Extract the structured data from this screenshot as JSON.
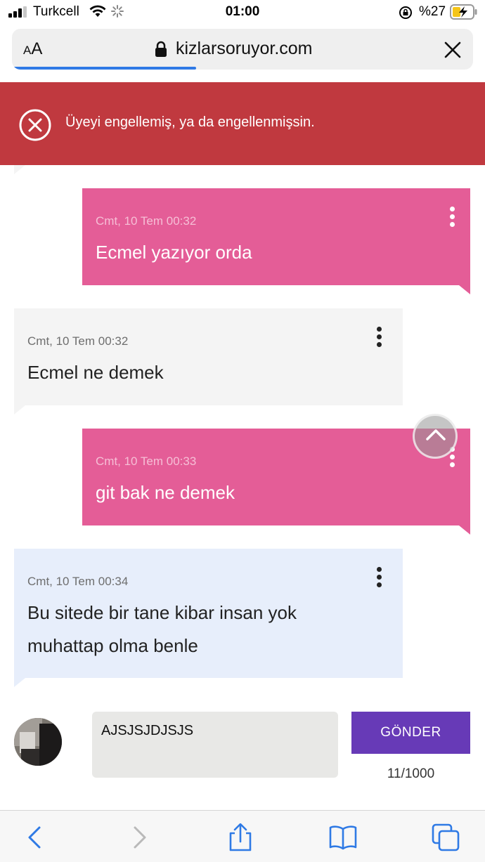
{
  "status_bar": {
    "carrier": "Turkcell",
    "time": "01:00",
    "battery": "%27"
  },
  "browser": {
    "text_size_small": "A",
    "text_size_large": "A",
    "url": "kizlarsoruyor.com",
    "load_progress": 0.4
  },
  "banner": {
    "message": "Üyeyi engellemiş, ya da engellenmişsin."
  },
  "messages": [
    {
      "side": "sent",
      "meta": "Cmt, 10 Tem 00:32",
      "lines": [
        "Ecmel yazıyor orda"
      ]
    },
    {
      "side": "received",
      "meta": "Cmt, 10 Tem 00:32",
      "lines": [
        "Ecmel ne demek"
      ]
    },
    {
      "side": "sent",
      "meta": "Cmt, 10 Tem 00:33",
      "lines": [
        "git bak ne demek"
      ]
    },
    {
      "side": "received",
      "meta": "Cmt, 10 Tem 00:34",
      "lines": [
        "Bu sitede bir tane kibar insan yok",
        "muhattap olma benle"
      ]
    }
  ],
  "composer": {
    "input_value": "AJSJSJDJSJS",
    "send_label": "GÖNDER",
    "counter": "11/1000"
  },
  "colors": {
    "banner": "#c0393f",
    "sent_bubble": "#e45d97",
    "received_bubble": "#f4f4f4",
    "received_bubble_alt": "#e7eefb",
    "send_button": "#673ab7",
    "progress": "#2f7ae5"
  },
  "icons": {
    "banner": "circle-x-icon",
    "message_menu": "more-vertical-icon",
    "scroll_top": "chevron-up-icon",
    "toolbar": [
      "back-icon",
      "forward-icon",
      "share-icon",
      "bookmarks-icon",
      "tabs-icon"
    ]
  }
}
